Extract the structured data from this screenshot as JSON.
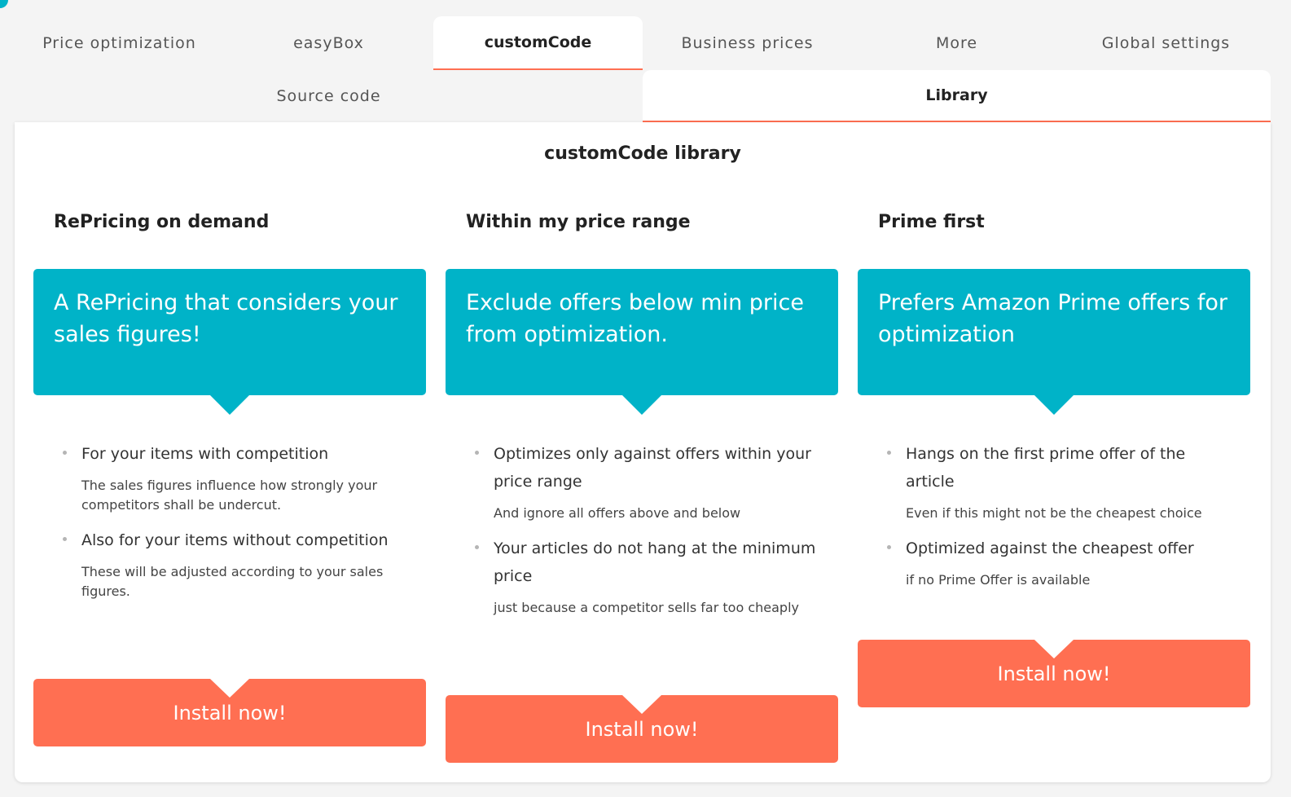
{
  "tabs": [
    {
      "label": "Price optimization"
    },
    {
      "label": "easyBox"
    },
    {
      "label": "customCode"
    },
    {
      "label": "Business prices"
    },
    {
      "label": "More"
    },
    {
      "label": "Global settings"
    }
  ],
  "subtabs": [
    {
      "label": "Source code"
    },
    {
      "label": "Library"
    }
  ],
  "colors": {
    "accent": "#ff6f52",
    "teal": "#00b3c8"
  },
  "library": {
    "title": "customCode library",
    "cards": [
      {
        "title": "RePricing on demand",
        "banner": "A RePricing that considers your sales figures!",
        "features": [
          {
            "main": "For your items with competition",
            "sub": "The sales figures influence how strongly your competitors shall be undercut."
          },
          {
            "main": "Also for your items without competition",
            "sub": "These will be adjusted according to your sales figures."
          }
        ],
        "button": "Install now!"
      },
      {
        "title": "Within my price range",
        "banner": "Exclude offers below min price from optimization.",
        "features": [
          {
            "main": "Optimizes only against offers within your price range",
            "sub": "And ignore all offers above and below"
          },
          {
            "main": "Your articles do not hang at the minimum price",
            "sub": "just because a competitor sells far too cheaply"
          }
        ],
        "button": "Install now!"
      },
      {
        "title": "Prime first",
        "banner": "Prefers Amazon Prime offers for optimization",
        "features": [
          {
            "main": "Hangs on the first prime offer of the article",
            "sub": "Even if this might not be the cheapest choice"
          },
          {
            "main": "Optimized against the cheapest offer",
            "sub": "if no Prime Offer is available"
          }
        ],
        "button": "Install now!"
      }
    ]
  }
}
